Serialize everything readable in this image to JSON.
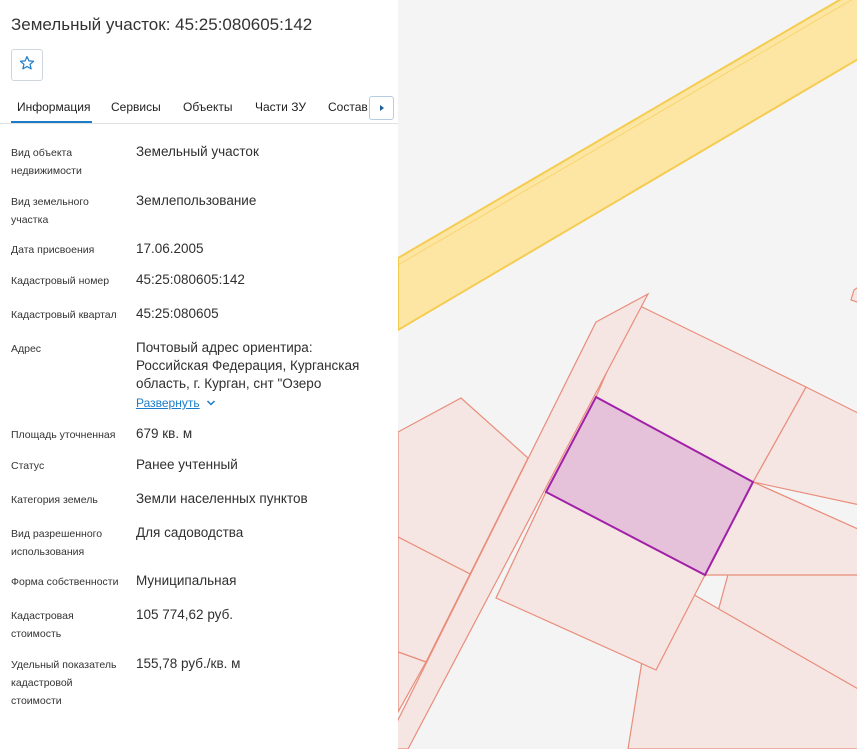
{
  "header": {
    "title": "Земельный участок: 45:25:080605:142",
    "favorite_icon": "star-outline-icon"
  },
  "tabs": [
    {
      "label": "Информация",
      "active": true
    },
    {
      "label": "Сервисы",
      "active": false
    },
    {
      "label": "Объекты",
      "active": false
    },
    {
      "label": "Части ЗУ",
      "active": false
    },
    {
      "label": "Состав",
      "active": false
    }
  ],
  "properties": [
    {
      "label": "Вид объекта недвижимости",
      "value": "Земельный участок"
    },
    {
      "label": "Вид земельного участка",
      "value": "Землепользование"
    },
    {
      "label": "Дата присвоения",
      "value": "17.06.2005"
    },
    {
      "label": "Кадастровый номер",
      "value": "45:25:080605:142"
    },
    {
      "label": "Кадастровый квартал",
      "value": "45:25:080605"
    },
    {
      "label": "Адрес",
      "value": "Почтовый адрес ориентира: Российская Федерация, Курганская область, г. Курган, снт \"Озеро"
    },
    {
      "label": "Площадь уточненная",
      "value": "679 кв. м"
    },
    {
      "label": "Статус",
      "value": "Ранее учтенный"
    },
    {
      "label": "Категория земель",
      "value": "Земли населенных пунктов"
    },
    {
      "label": "Вид разрешенного использования",
      "value": "Для садоводства"
    },
    {
      "label": "Форма собственности",
      "value": "Муниципальная"
    },
    {
      "label": "Кадастровая стоимость",
      "value": "105 774,62 руб."
    },
    {
      "label": "Удельный показатель кадастровой стоимости",
      "value": "155,78 руб./кв. м"
    }
  ],
  "address_expand": {
    "label": "Развернуть",
    "icon": "chevron-down-icon"
  },
  "colors": {
    "accent": "#1c7cc9",
    "road_fill": "#fde6a3",
    "road_edge": "#f5cc52",
    "parcel_fill": "#f6e6e3",
    "parcel_stroke": "#e98d7b",
    "selected_fill": "#e6c1da",
    "selected_stroke": "#a020a8"
  }
}
